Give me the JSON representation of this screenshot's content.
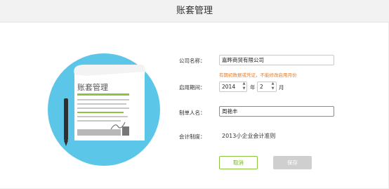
{
  "window": {
    "title": "账套管理"
  },
  "illustration": {
    "doc_title": "账套管理",
    "accent": "#8cc43e",
    "circle": "#5cc6e8"
  },
  "form": {
    "company": {
      "label": "公司名称：",
      "value": "嘉晔商贸有限公司"
    },
    "hint": "有期初数据或凭证，不能修改启用月份",
    "start": {
      "label": "启用期间：",
      "year": "2014",
      "year_unit": "年",
      "month": "2",
      "month_unit": "月"
    },
    "maker": {
      "label": "制单人名：",
      "value": "周艳丰"
    },
    "system": {
      "label": "会计制度：",
      "value": "2013小企业会计准则"
    }
  },
  "buttons": {
    "cancel": "取消",
    "save": "保存"
  }
}
